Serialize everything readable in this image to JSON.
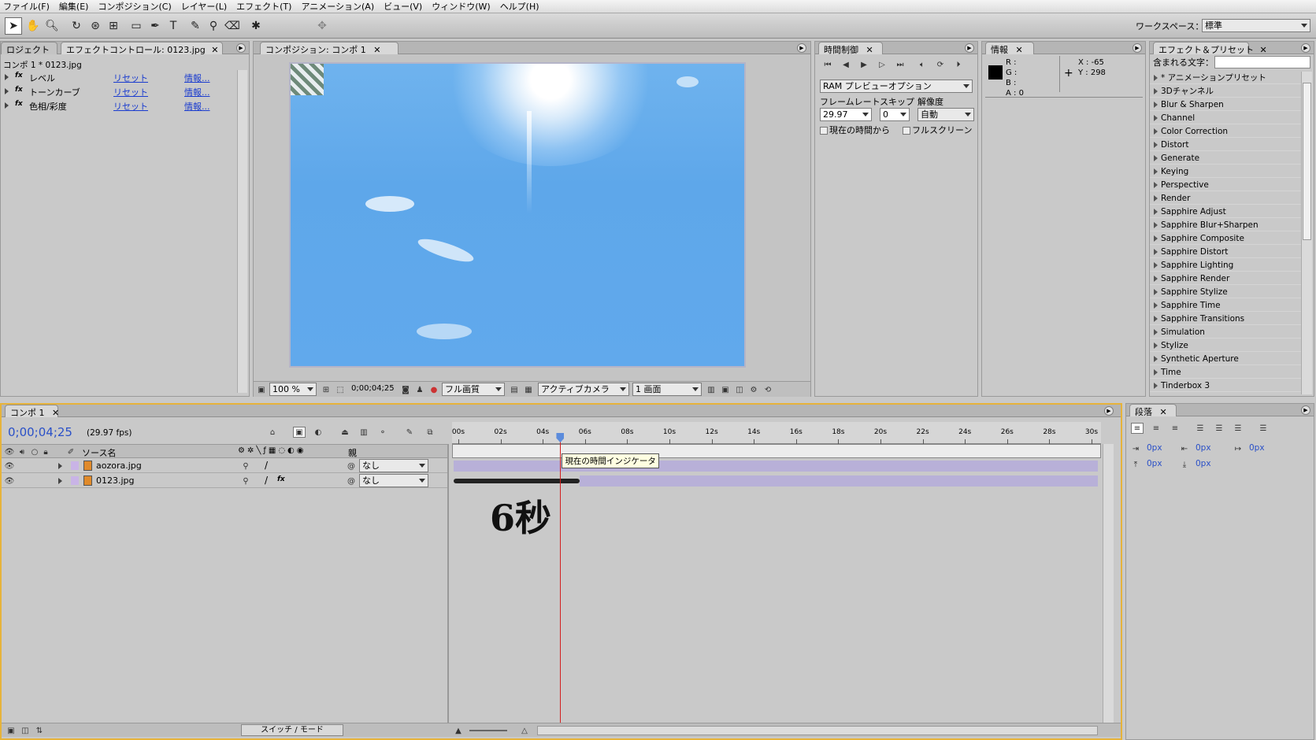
{
  "menu": [
    "ファイル(F)",
    "編集(E)",
    "コンポジション(C)",
    "レイヤー(L)",
    "エフェクト(T)",
    "アニメーション(A)",
    "ビュー(V)",
    "ウィンドウ(W)",
    "ヘルプ(H)"
  ],
  "workspace": {
    "label": "ワークスペース：",
    "value": "標準"
  },
  "effects_panel": {
    "tab_project": "ロジェクト",
    "tab_effects": "エフェクトコントロール: 0123.jpg",
    "subtitle": "コンポ 1 * 0123.jpg",
    "rows": [
      {
        "name": "レベル",
        "reset": "リセット",
        "info": "情報..."
      },
      {
        "name": "トーンカーブ",
        "reset": "リセット",
        "info": "情報..."
      },
      {
        "name": "色相/彩度",
        "reset": "リセット",
        "info": "情報..."
      }
    ],
    "fx": "fx"
  },
  "comp_panel": {
    "tab": "コンポジション: コンポ 1",
    "zoom": "100 %",
    "timecode": "0;00;04;25",
    "quality": "フル画質",
    "camera": "アクティブカメラ",
    "views": "1 画面"
  },
  "time_panel": {
    "tab": "時間制御",
    "ram_preview": "RAM プレビューオプション",
    "framerate_label": "フレームレート",
    "skip_label": "スキップ",
    "resolution_label": "解像度",
    "framerate": "29.97",
    "skip": "0",
    "resolution": "自動",
    "from_current": "現在の時間から",
    "fullscreen": "フルスクリーン"
  },
  "info_panel": {
    "tab": "情報",
    "r": "R :",
    "g": "G :",
    "b": "B :",
    "a": "A : 0",
    "x": "X : -65",
    "y": "Y : 298"
  },
  "presets_panel": {
    "tab": "エフェクト＆プリセット",
    "search_label": "含まれる文字：",
    "items": [
      "* アニメーションプリセット",
      "3Dチャンネル",
      "Blur & Sharpen",
      "Channel",
      "Color Correction",
      "Distort",
      "Generate",
      "Keying",
      "Perspective",
      "Render",
      "Sapphire Adjust",
      "Sapphire Blur+Sharpen",
      "Sapphire Composite",
      "Sapphire Distort",
      "Sapphire Lighting",
      "Sapphire Render",
      "Sapphire Stylize",
      "Sapphire Time",
      "Sapphire Transitions",
      "Simulation",
      "Stylize",
      "Synthetic Aperture",
      "Time",
      "Tinderbox 3"
    ]
  },
  "timeline": {
    "tab": "コンポ 1",
    "timecode": "0;00;04;25",
    "fps": "(29.97 fps)",
    "col_source": "ソース名",
    "col_parent": "親",
    "layers": [
      {
        "index": "1",
        "name": "aozora.jpg",
        "parent": "なし"
      },
      {
        "index": "2",
        "name": "0123.jpg",
        "parent": "なし"
      }
    ],
    "ticks": [
      "00s",
      "02s",
      "04s",
      "06s",
      "08s",
      "10s",
      "12s",
      "14s",
      "16s",
      "18s",
      "20s",
      "22s",
      "24s",
      "26s",
      "28s",
      "30s"
    ],
    "current_time_seconds": 4.83,
    "duration_seconds": 30,
    "tooltip": "現在の時間インジケータ",
    "annotation": "6秒",
    "switch_mode": "スイッチ / モード"
  },
  "paragraph_panel": {
    "tab": "段落",
    "values": [
      "0px",
      "0px",
      "0px",
      "0px",
      "0px"
    ]
  }
}
